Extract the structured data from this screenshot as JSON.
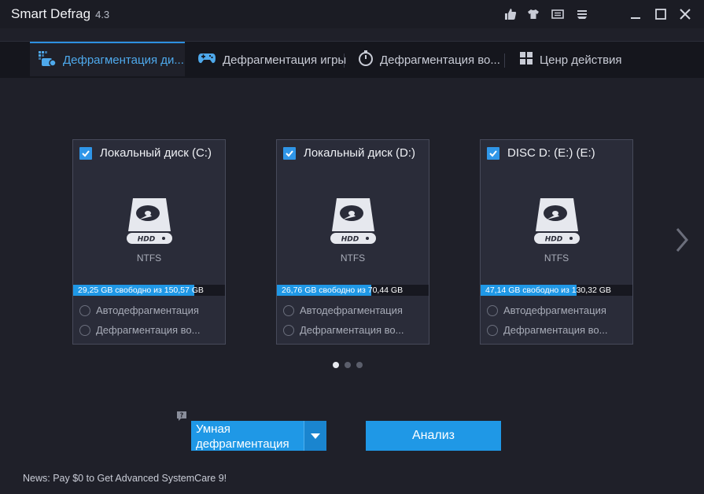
{
  "app": {
    "title": "Smart Defrag",
    "version": "4.3"
  },
  "tabs": [
    {
      "label": "Дефрагментация ди...",
      "active": true
    },
    {
      "label": "Дефрагментация игры",
      "active": false
    },
    {
      "label": "Дефрагментация во...",
      "active": false
    },
    {
      "label": "Ценр действия",
      "active": false
    }
  ],
  "disks": [
    {
      "name": "Локальный диск (C:)",
      "icon_label": "HDD",
      "fs": "NTFS",
      "capacity": "29,25 GB свободно из 150,57 GB",
      "free_fraction": 0.8,
      "checked": true,
      "options": [
        "Автодефрагментация",
        "Дефрагментация во..."
      ]
    },
    {
      "name": "Локальный диск (D:)",
      "icon_label": "HDD",
      "fs": "NTFS",
      "capacity": "26,76 GB свободно из 70,44 GB",
      "free_fraction": 0.62,
      "checked": true,
      "options": [
        "Автодефрагментация",
        "Дефрагментация во..."
      ]
    },
    {
      "name": "DISC D: (E:) (E:)",
      "icon_label": "HDD",
      "fs": "NTFS",
      "capacity": "47,14 GB свободно из 130,32 GB",
      "free_fraction": 0.63,
      "checked": true,
      "options": [
        "Автодефрагментация",
        "Дефрагментация во..."
      ]
    }
  ],
  "pagination": {
    "pages": 3,
    "current": 1
  },
  "mode_select": {
    "value": "Умная дефрагментация"
  },
  "analyze_label": "Анализ",
  "news": "News: Pay $0 to Get Advanced SystemCare 9!",
  "colors": {
    "accent": "#1f98e6",
    "background": "#1f2029",
    "card": "#2a2c39"
  }
}
